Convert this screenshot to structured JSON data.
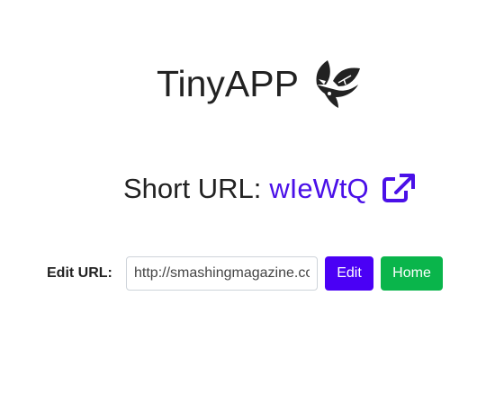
{
  "brand": {
    "title": "TinyAPP",
    "logo_icon": "leaf-fox-logo-icon"
  },
  "short_url": {
    "label": "Short URL:",
    "code": "wIeWtQ",
    "link_color": "#4a10e8",
    "external_icon": "external-link-icon"
  },
  "edit": {
    "label": "Edit URL:",
    "input_value": "http://smashingmagazine.com",
    "edit_button": "Edit",
    "home_button": "Home",
    "edit_color": "#4a00f5",
    "home_color": "#0ab54b"
  }
}
